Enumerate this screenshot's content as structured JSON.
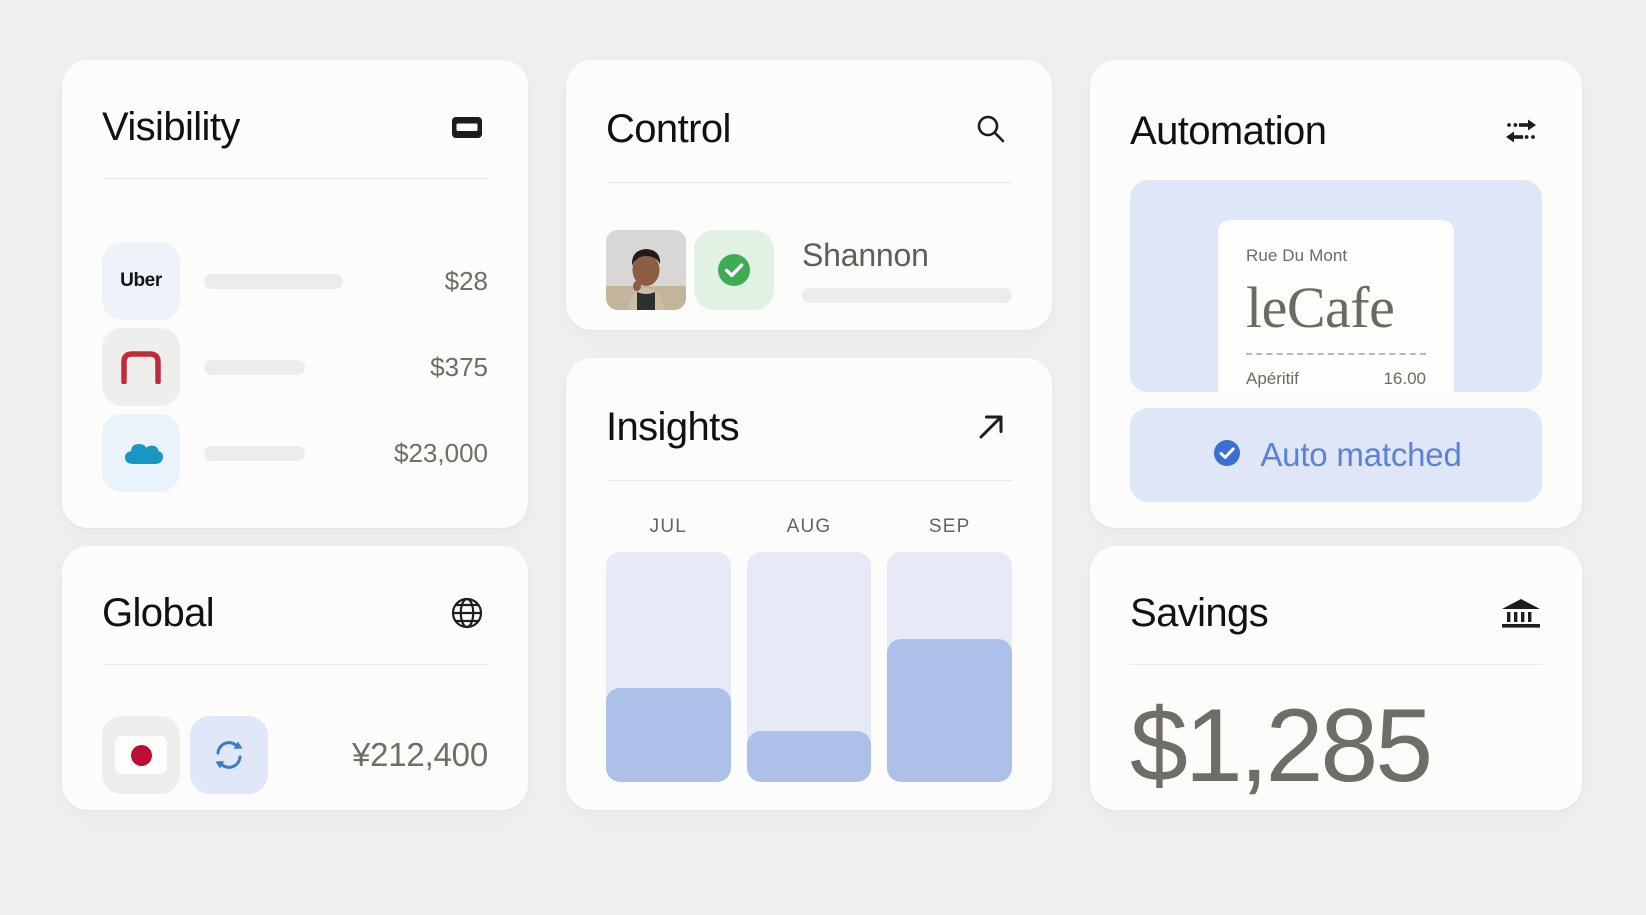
{
  "theme": {
    "page_bg": "#efefed",
    "card_bg": "#fcfcfb",
    "text_dark": "#111111",
    "text_muted": "#6e6d66",
    "accent_blue": "#3b6fd4",
    "accent_blue_light": "#5b82d9",
    "accent_green": "#3eab55",
    "bar_fill": "#adc0e9",
    "bar_track": "#e6eaf7",
    "tile_blue": "#dfe6f7"
  },
  "visibility": {
    "title": "Visibility",
    "icon": "credit-card-icon",
    "rows": [
      {
        "logo": "uber-logo",
        "logo_text": "Uber",
        "bar_pct": 62,
        "amount": "$28"
      },
      {
        "logo": "airbnb-arch-logo",
        "logo_text": "",
        "bar_pct": 48,
        "amount": "$375"
      },
      {
        "logo": "salesforce-cloud-logo",
        "logo_text": "",
        "bar_pct": 58,
        "amount": "$23,000"
      }
    ]
  },
  "control": {
    "title": "Control",
    "icon": "search-icon",
    "avatar": "user-avatar-photo",
    "status_icon": "check-circle-icon",
    "name": "Shannon",
    "detail_bar_pct": 100
  },
  "automation": {
    "title": "Automation",
    "icon": "swap-arrows-icon",
    "receipt": {
      "street": "Rue Du Mont",
      "brand": "leCafe",
      "line_item": "Apéritif",
      "line_amount": "16.00"
    },
    "badge": {
      "icon": "check-circle-filled-icon",
      "label": "Auto matched"
    }
  },
  "insights": {
    "title": "Insights",
    "icon": "arrow-up-right-icon"
  },
  "chart_data": {
    "type": "bar",
    "title": "Insights",
    "categories": [
      "JUL",
      "AUG",
      "SEP"
    ],
    "values": [
      41,
      22,
      62
    ],
    "ylim": [
      0,
      100
    ],
    "xlabel": "",
    "ylabel": "",
    "grid": false,
    "legend": "none",
    "note": "Stacked-style track bars; values are filled percentage of each full-height track"
  },
  "global": {
    "title": "Global",
    "icon": "globe-icon",
    "flag_icon": "japan-flag-icon",
    "fx_icon": "currency-exchange-icon",
    "amount": "¥212,400"
  },
  "savings": {
    "title": "Savings",
    "icon": "bank-icon",
    "amount": "$1,285"
  }
}
